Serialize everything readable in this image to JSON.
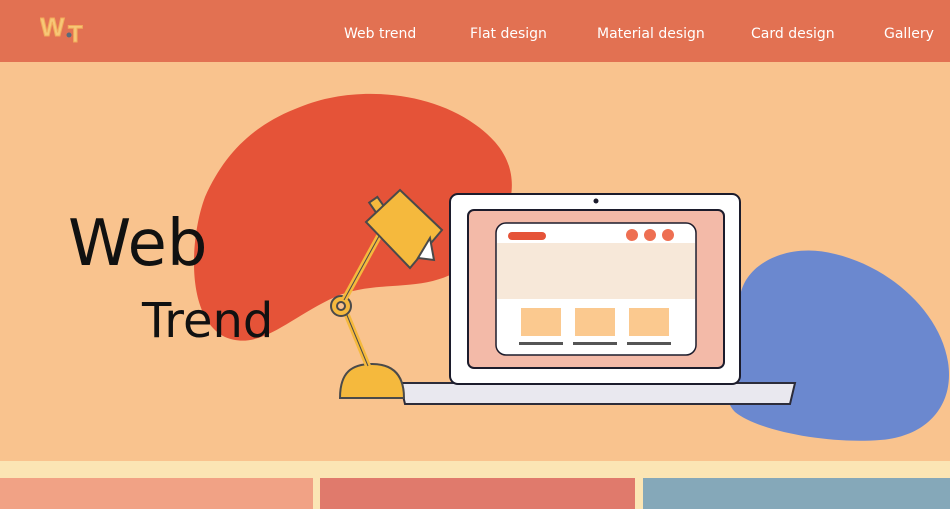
{
  "header": {
    "logo_text": "W.T",
    "nav": [
      {
        "label": "Web trend"
      },
      {
        "label": "Flat design"
      },
      {
        "label": "Material design"
      },
      {
        "label": "Card design"
      },
      {
        "label": "Gallery"
      }
    ]
  },
  "hero": {
    "title_line1": "Web",
    "title_line2": "Trend",
    "illustration": {
      "icons": [
        "desk-lamp-icon",
        "laptop-icon",
        "browser-window-icon"
      ]
    }
  },
  "colors": {
    "header_bg": "#e27152",
    "hero_bg": "#f9c38e",
    "blob_red": "#e55338",
    "blob_blue": "#6b88cf",
    "lamp_yellow": "#f5b93d",
    "card_1": "#f1a285",
    "card_2": "#e07a6c",
    "card_3": "#85a8b9"
  }
}
